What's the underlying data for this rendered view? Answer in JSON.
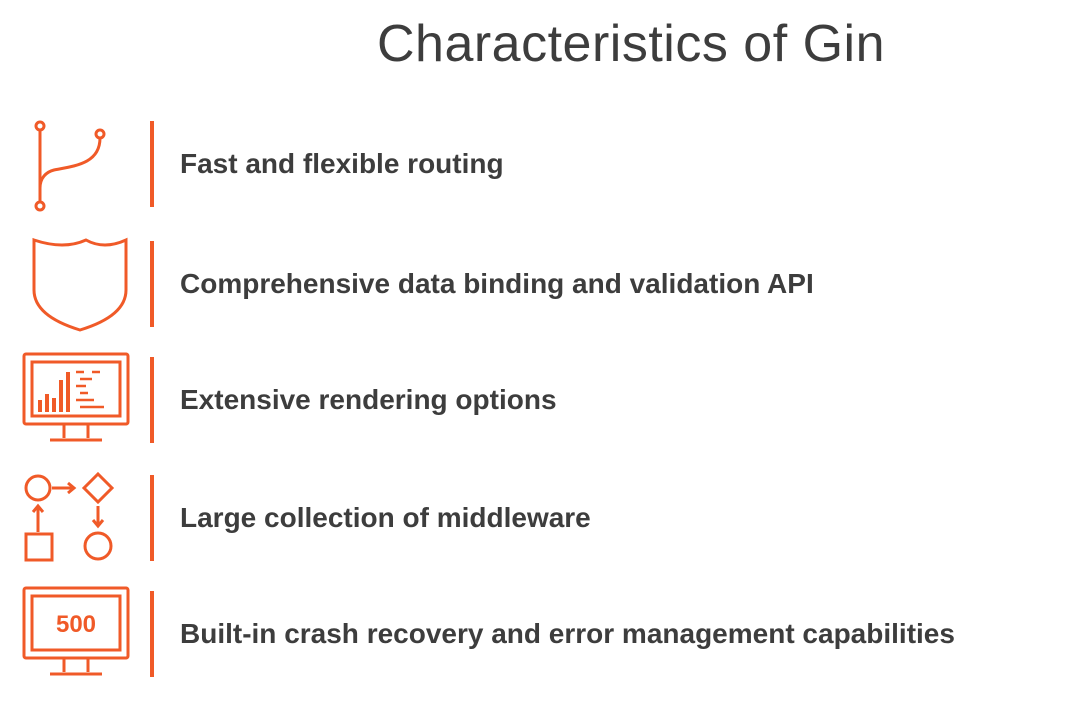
{
  "slide": {
    "title": "Characteristics of Gin",
    "accent_color": "#f05a28",
    "items": [
      {
        "icon": "routing-path-icon",
        "label": "Fast and flexible routing"
      },
      {
        "icon": "shield-icon",
        "label": "Comprehensive data binding and validation API"
      },
      {
        "icon": "monitor-chart-icon",
        "label": "Extensive rendering options"
      },
      {
        "icon": "flowchart-icon",
        "label": "Large collection of middleware"
      },
      {
        "icon": "monitor-error-icon",
        "label": "Built-in crash recovery and error management capabilities",
        "icon_text": "500"
      }
    ]
  }
}
